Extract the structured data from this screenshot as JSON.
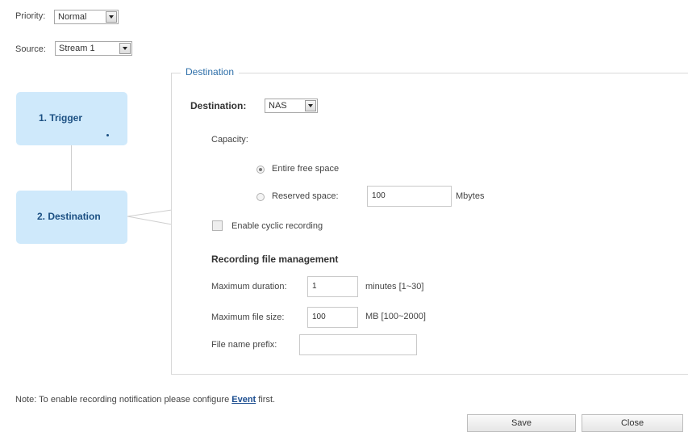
{
  "top": {
    "priority_label": "Priority:",
    "priority_value": "Normal",
    "source_label": "Source:",
    "source_value": "Stream 1"
  },
  "steps": [
    {
      "label": "1.  Trigger"
    },
    {
      "label": "2.  Destination"
    }
  ],
  "section": {
    "legend": "Destination",
    "destination_label": "Destination:",
    "destination_value": "NAS",
    "capacity_label": "Capacity:",
    "option_entire": "Entire free space",
    "option_reserved": "Reserved space:",
    "reserved_value": "100",
    "reserved_unit": "Mbytes",
    "cyclic_label": "Enable cyclic recording",
    "file_mgmt_title": "Recording file management",
    "max_duration_label": "Maximum duration:",
    "max_duration_value": "1",
    "max_duration_range": "minutes [1~30]",
    "max_size_label": "Maximum file size:",
    "max_size_value": "100",
    "max_size_range": "MB [100~2000]",
    "prefix_label": "File name prefix:",
    "prefix_value": ""
  },
  "note": {
    "prefix": "Note: To enable recording notification please configure ",
    "link": "Event",
    "suffix": " first."
  },
  "buttons": {
    "save": "Save",
    "close": "Close"
  },
  "colors": {
    "accent": "#2e6fa9",
    "step_bg": "#cfe9fb",
    "step_text": "#1b4f82"
  }
}
